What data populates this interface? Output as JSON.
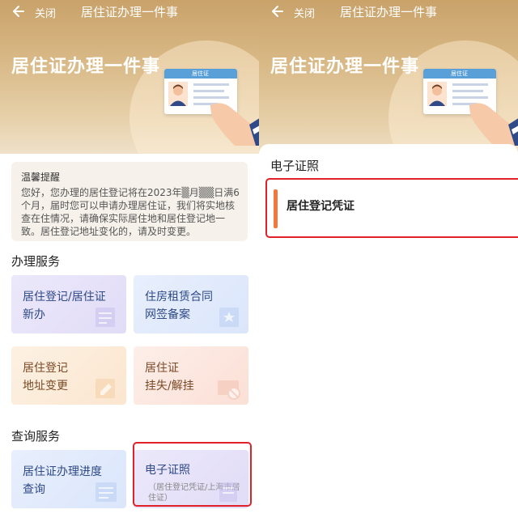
{
  "topbar": {
    "close_label": "关闭",
    "title": "居住证办理一件事"
  },
  "hero": {
    "title": "居住证办理一件事",
    "card_header": "居住证"
  },
  "notice": {
    "title": "温馨提醒",
    "text": "您好，您办理的居住登记将在2023年▒月▒▒日满6个月，届时您可以申请办理居住证，我们将实地核查在住情况，请确保实际居住地和居住登记地一致。居住登记地址变化的，请及时变更。"
  },
  "services": {
    "title": "办理服务",
    "tiles": [
      {
        "label": "居住登记/居住证\n新办",
        "icon": "form-icon"
      },
      {
        "label": "住房租赁合同\n网签备案",
        "icon": "certificate-icon"
      },
      {
        "label": "居住登记\n地址变更",
        "icon": "edit-form-icon"
      },
      {
        "label": "居住证\n挂失/解挂",
        "icon": "card-block-icon"
      }
    ]
  },
  "query": {
    "title": "查询服务",
    "tiles": [
      {
        "label": "居住证办理进度\n查询",
        "icon": "progress-icon"
      },
      {
        "label": "电子证照",
        "sub": "（居住登记凭证/上海市居住证）",
        "icon": "e-cert-icon"
      }
    ]
  },
  "right": {
    "sheet_title": "电子证照",
    "items": [
      {
        "label": "居住登记凭证"
      }
    ]
  },
  "colors": {
    "highlight_red": "#e0212a",
    "accent_orange": "#f07a3c",
    "header_gold": "#c9a26a"
  }
}
